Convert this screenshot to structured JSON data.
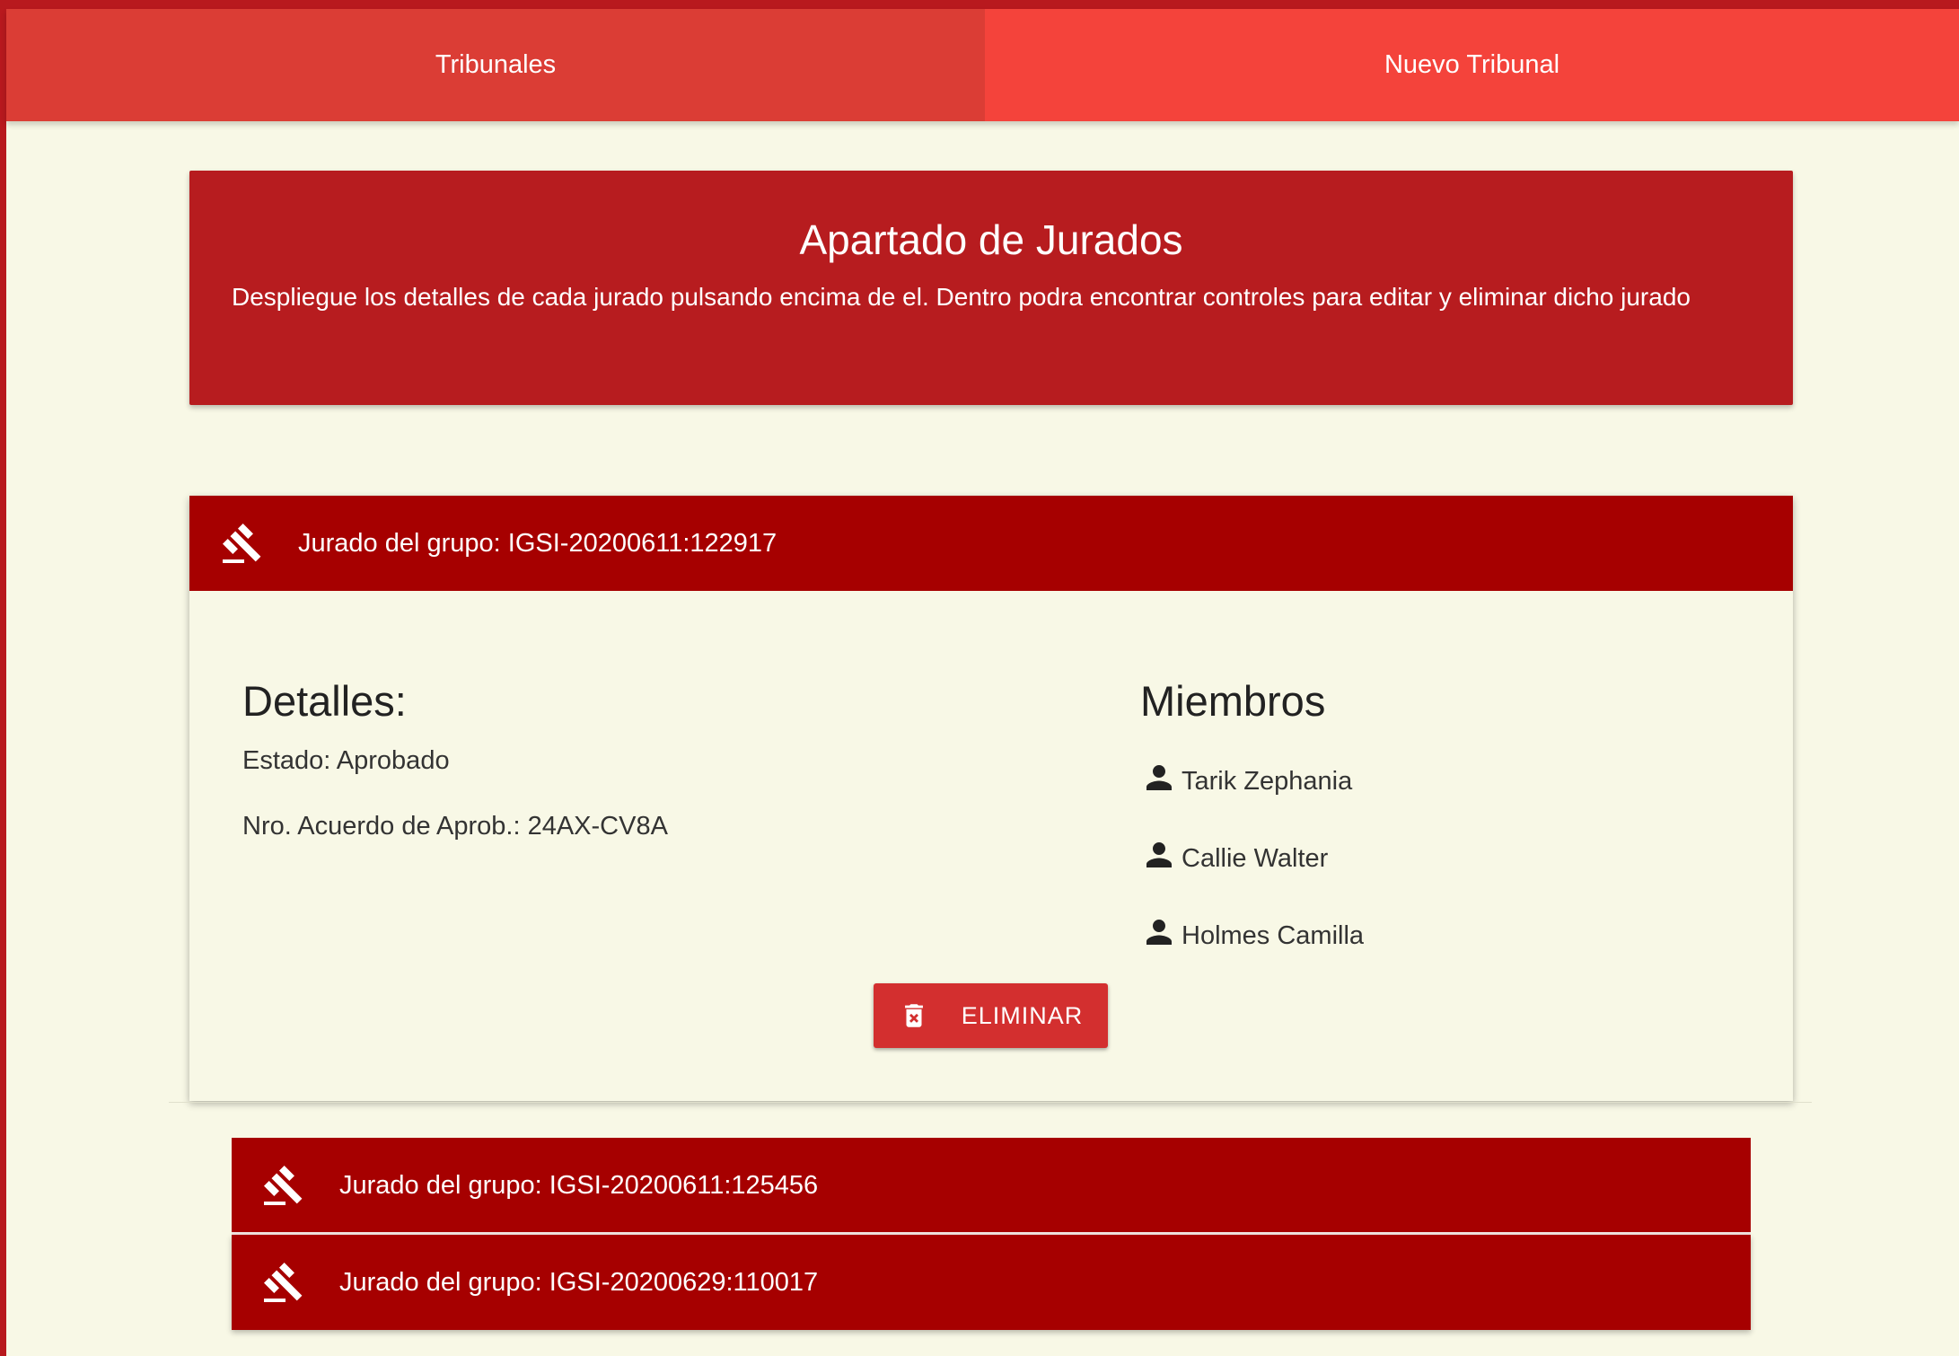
{
  "nav": {
    "tabs": [
      {
        "label": "Tribunales"
      },
      {
        "label": "Nuevo Tribunal"
      }
    ]
  },
  "banner": {
    "title": "Apartado de Jurados",
    "description": "Despliegue los detalles de cada jurado pulsando encima de el. Dentro podra encontrar controles para editar y eliminar dicho jurado"
  },
  "panels": [
    {
      "title": "Jurado del grupo: IGSI-20200611:122917",
      "icon": "gavel-icon",
      "expanded": true,
      "details": {
        "heading": "Detalles:",
        "estado": "Estado: Aprobado",
        "acuerdo": "Nro. Acuerdo de Aprob.: 24AX-CV8A"
      },
      "members": {
        "heading": "Miembros",
        "icon": "person-icon",
        "list": [
          "Tarik Zephania",
          "Callie Walter",
          "Holmes Camilla"
        ]
      },
      "delete_label": "ELIMINAR",
      "delete_icon": "trash-icon"
    },
    {
      "title": "Jurado del grupo: IGSI-20200611:125456",
      "icon": "gavel-icon",
      "expanded": false
    },
    {
      "title": "Jurado del grupo: IGSI-20200629:110017",
      "icon": "gavel-icon",
      "expanded": false
    }
  ],
  "colors": {
    "page_background": "#f8f8e6",
    "tab_active": "#db3d35",
    "tab_inactive": "#f4433b",
    "banner": "#b71c1f",
    "panel_header": "#a60000",
    "delete_button": "#d32f2f"
  }
}
